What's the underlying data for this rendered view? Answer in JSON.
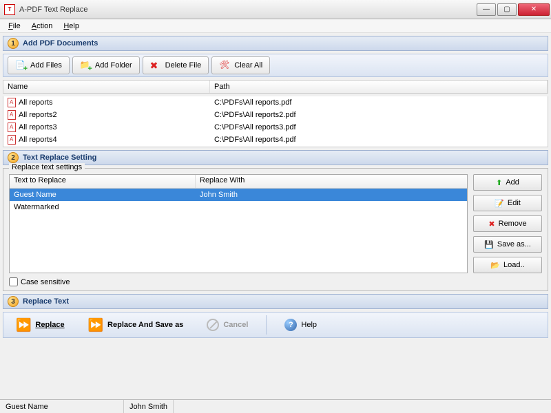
{
  "window": {
    "title": "A-PDF Text Replace"
  },
  "menu": {
    "file": "File",
    "action": "Action",
    "help": "Help"
  },
  "section1": {
    "step": "1",
    "title": "Add PDF Documents",
    "toolbar": {
      "addFiles": "Add Files",
      "addFolder": "Add Folder",
      "deleteFile": "Delete File",
      "clearAll": "Clear All"
    },
    "columns": {
      "name": "Name",
      "path": "Path"
    },
    "files": [
      {
        "name": "All reports",
        "path": "C:\\PDFs\\All reports.pdf"
      },
      {
        "name": "All reports2",
        "path": "C:\\PDFs\\All reports2.pdf"
      },
      {
        "name": "All reports3",
        "path": "C:\\PDFs\\All reports3.pdf"
      },
      {
        "name": "All reports4",
        "path": "C:\\PDFs\\All reports4.pdf"
      }
    ]
  },
  "section2": {
    "step": "2",
    "title": "Text Replace Setting",
    "groupLegend": "Replace text settings",
    "columns": {
      "textToReplace": "Text to Replace",
      "replaceWith": "Replace With"
    },
    "rows": [
      {
        "text": "Guest Name",
        "with": "John Smith",
        "selected": true
      },
      {
        "text": "Watermarked",
        "with": "",
        "selected": false
      }
    ],
    "buttons": {
      "add": "Add",
      "edit": "Edit",
      "remove": "Remove",
      "saveAs": "Save as...",
      "load": "Load.."
    },
    "caseSensitive": "Case sensitive"
  },
  "section3": {
    "step": "3",
    "title": "Replace Text",
    "buttons": {
      "replace": "Replace",
      "replaceSaveAs": "Replace And Save as",
      "cancel": "Cancel",
      "help": "Help"
    }
  },
  "status": {
    "left": "Guest Name",
    "right": "John Smith"
  }
}
